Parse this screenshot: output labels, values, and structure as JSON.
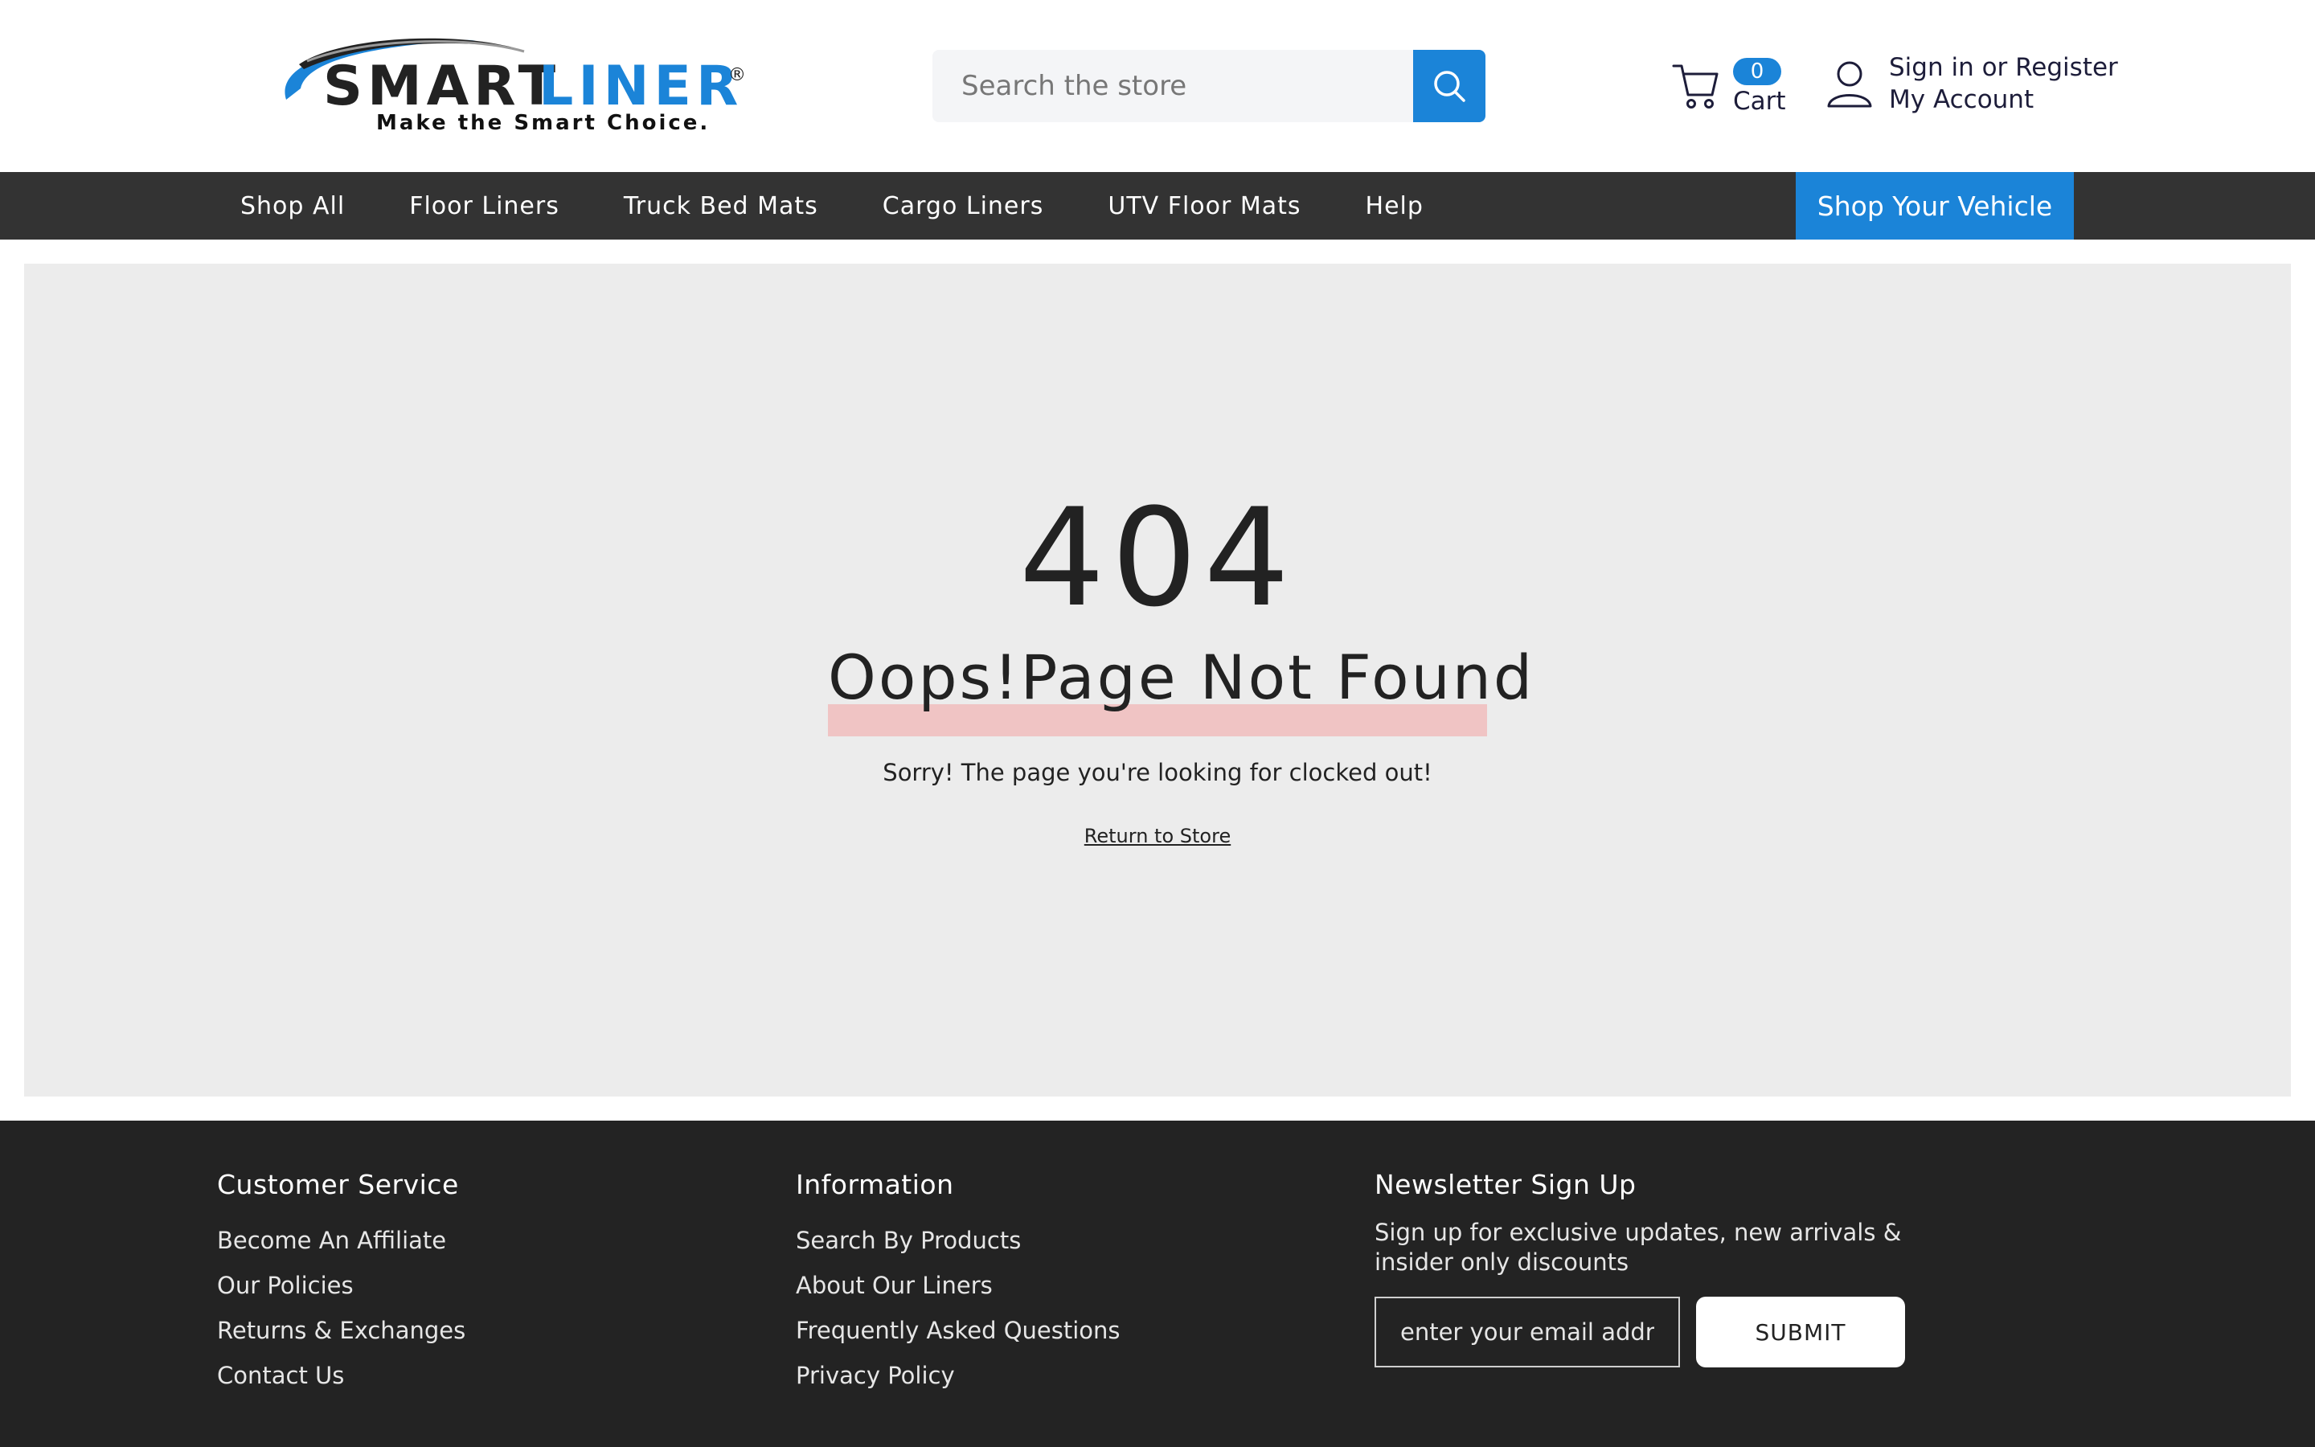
{
  "header": {
    "logo": {
      "brand_part1": "SMART",
      "brand_part2": "LINER",
      "registered": "®",
      "tagline": "Make the Smart Choice."
    },
    "search": {
      "placeholder": "Search the store",
      "icon": "search-icon"
    },
    "cart": {
      "icon": "cart-icon",
      "count": "0",
      "label": "Cart"
    },
    "account": {
      "icon": "user-icon",
      "sign_in": "Sign in",
      "or": " or ",
      "register": "Register",
      "my_account": "My Account"
    }
  },
  "nav": {
    "items": [
      {
        "label": "Shop All"
      },
      {
        "label": "Floor Liners"
      },
      {
        "label": "Truck Bed Mats"
      },
      {
        "label": "Cargo Liners"
      },
      {
        "label": "UTV Floor Mats"
      },
      {
        "label": "Help"
      }
    ],
    "cta": "Shop Your Vehicle"
  },
  "error": {
    "code": "404",
    "title": "Oops!Page Not Found",
    "message": "Sorry! The page you're looking for clocked out!",
    "link": "Return to Store"
  },
  "footer": {
    "customer_service": {
      "heading": "Customer Service",
      "links": [
        "Become An Affiliate",
        "Our Policies",
        "Returns & Exchanges",
        "Contact Us"
      ]
    },
    "information": {
      "heading": "Information",
      "links": [
        "Search By Products",
        "About Our Liners",
        "Frequently Asked Questions",
        "Privacy Policy"
      ]
    },
    "newsletter": {
      "heading": "Newsletter Sign Up",
      "text": "Sign up for exclusive updates, new arrivals & insider only discounts",
      "placeholder": "enter your email address",
      "submit": "SUBMIT"
    }
  },
  "colors": {
    "accent": "#1b84d8",
    "nav_bg": "#333333",
    "main_bg": "#ececec",
    "footer_bg": "#232323",
    "highlight": "#f0c4c4"
  }
}
